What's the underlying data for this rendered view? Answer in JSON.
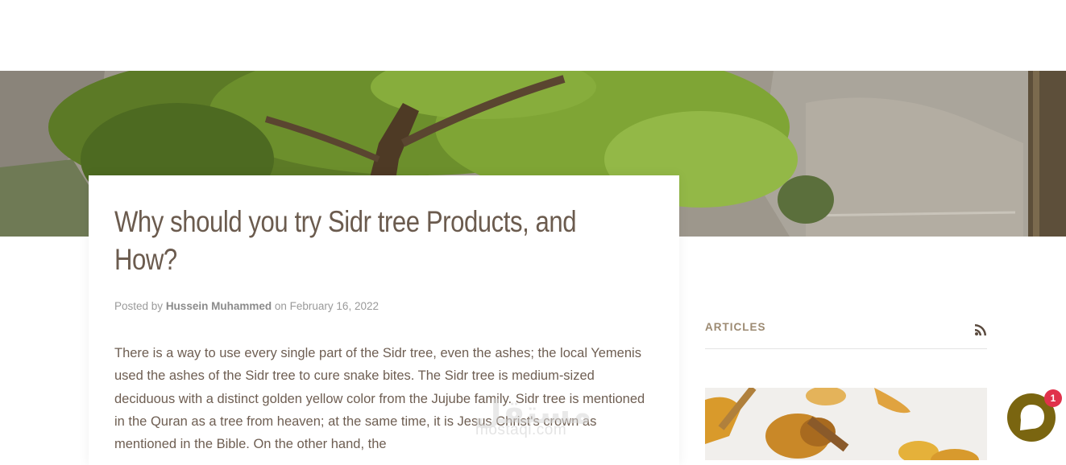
{
  "article": {
    "title": "Why should you try Sidr tree Products, and How?",
    "posted_by_prefix": "Posted by",
    "author": "Hussein Muhammed",
    "date_prefix": "on",
    "date": "February 16, 2022",
    "body": "There is a way to use every single part of the Sidr tree, even the ashes; the local Yemenis used the ashes of the Sidr tree to cure snake bites. The Sidr tree is medium-sized deciduous with a distinct golden yellow color from the Jujube family. Sidr tree is mentioned in the Quran as a tree from heaven; at the same time, it is Jesus Christ's crown as mentioned in the Bible. On the other hand, the"
  },
  "sidebar": {
    "heading": "ARTICLES",
    "rss_icon": "rss-icon",
    "image_icon": "honey-image"
  },
  "chat": {
    "badge_count": "1",
    "icon": "chat-bubble-icon",
    "accent_color": "#7a6510",
    "badge_color": "#e0324b"
  },
  "watermark": {
    "glyph": "مستقل",
    "text": "mostaql.com"
  },
  "colors": {
    "title": "#6b5b4e",
    "body_text": "#6e5e52",
    "sidebar_heading": "#9c8a72"
  }
}
